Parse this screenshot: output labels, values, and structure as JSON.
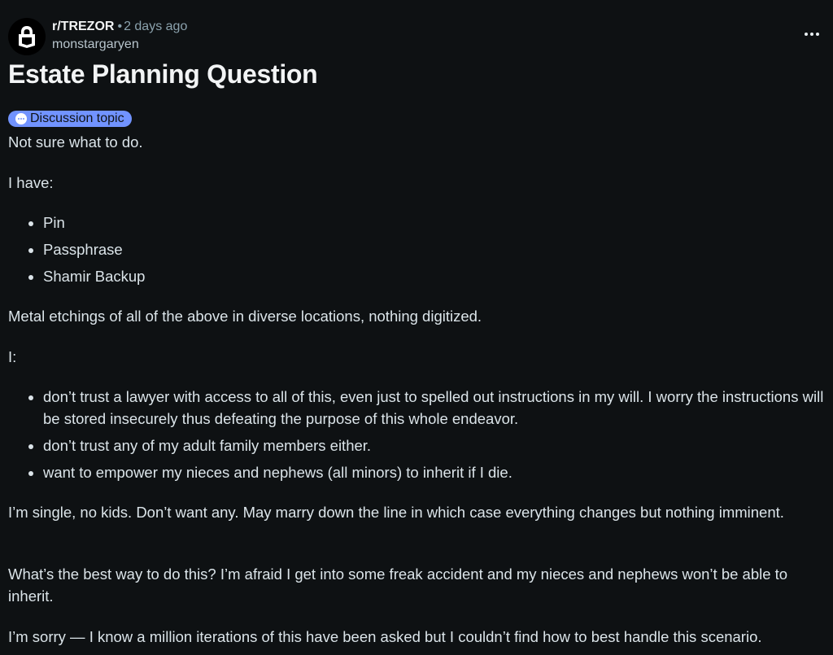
{
  "post": {
    "subreddit": "r/TREZOR",
    "separator": "•",
    "time_ago": "2 days ago",
    "author": "monstargaryen",
    "more_icon": "more-horizontal-icon",
    "title": "Estate Planning Question",
    "flair": {
      "label": "Discussion topic",
      "icon": "speech-bubble-icon",
      "color": "#7193ff"
    },
    "body": {
      "p1": "Not sure what to do.",
      "p2": "I have:",
      "list1": [
        "Pin",
        "Passphrase",
        "Shamir Backup"
      ],
      "p3": "Metal etchings of all of the above in diverse locations, nothing digitized.",
      "p4": "I:",
      "list2": [
        "don’t trust a lawyer with access to all of this, even just to spelled out instructions in my will. I worry the instructions will be stored insecurely thus defeating the purpose of this whole endeavor.",
        "don’t trust any of my adult family members either.",
        "want to empower my nieces and nephews (all minors) to inherit if I die."
      ],
      "p5": "I’m single, no kids. Don’t want any. May marry down the line in which case everything changes but nothing imminent.",
      "p6": "What’s the best way to do this? I’m afraid I get into some freak accident and my nieces and nephews won’t be able to inherit.",
      "p7": "I’m sorry — I know a million iterations of this have been asked but I couldn’t find how to best handle this scenario."
    }
  },
  "colors": {
    "background": "#0e1113",
    "text": "#dbe4e9",
    "muted": "#8ba2ad",
    "flair": "#7193ff"
  }
}
